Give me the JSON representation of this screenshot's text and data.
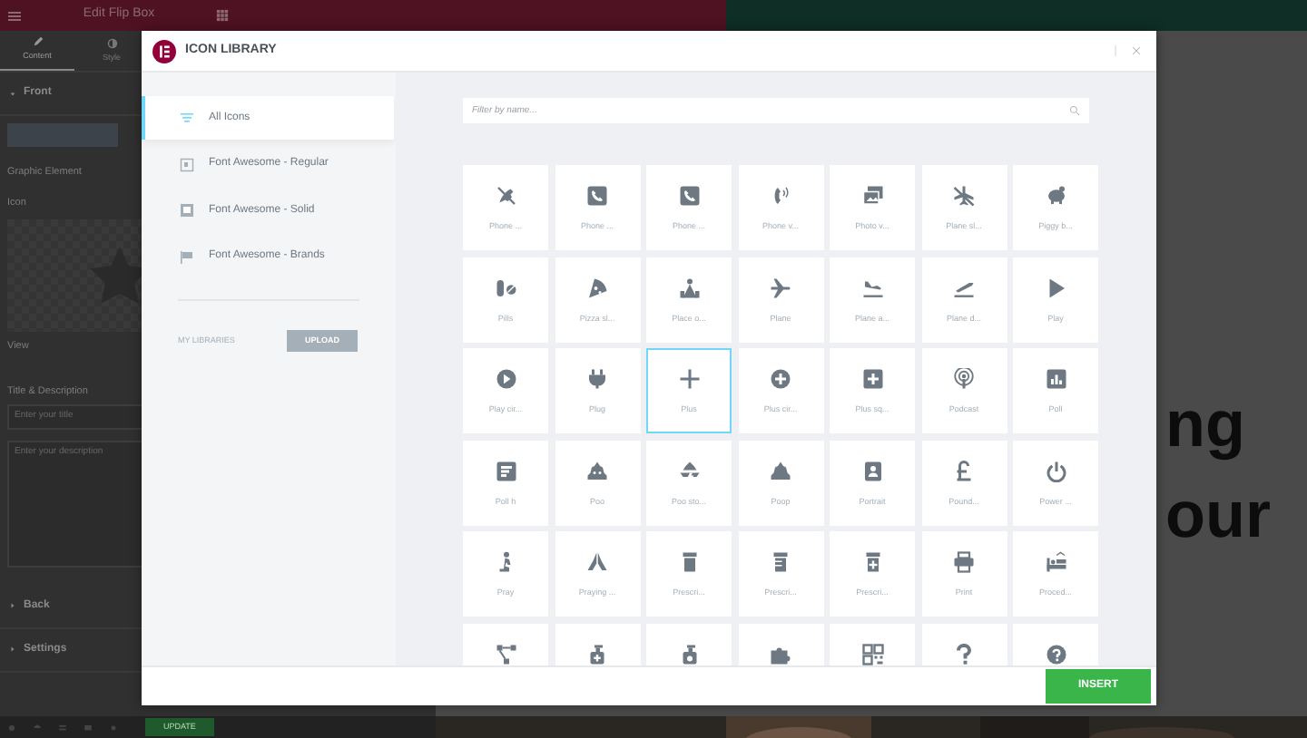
{
  "editor": {
    "title": "Edit Flip Box",
    "tabs": [
      {
        "label": "Content",
        "selected": true
      },
      {
        "label": "Style",
        "selected": false
      }
    ],
    "sections": [
      {
        "label": "Front",
        "expanded": true
      },
      {
        "label": "Back",
        "expanded": false
      },
      {
        "label": "Settings",
        "expanded": false
      }
    ],
    "graphic_element_label": "Graphic Element",
    "icon_label": "Icon",
    "view_label": "View",
    "title_description_label": "Title & Description",
    "title_field": {
      "placeholder": "Enter your title"
    },
    "description_field": {
      "placeholder": "Enter your description"
    },
    "update_button": "UPDATE"
  },
  "page": {
    "heading_lines": [
      "ng",
      "our"
    ]
  },
  "modal": {
    "title": "ICON LIBRARY",
    "categories": [
      {
        "label": "All Icons",
        "selected": true
      },
      {
        "label": "Font Awesome - Regular",
        "selected": false
      },
      {
        "label": "Font Awesome - Solid",
        "selected": false
      },
      {
        "label": "Font Awesome - Brands",
        "selected": false
      }
    ],
    "my_libraries_label": "MY LIBRARIES",
    "upload_button": "UPLOAD",
    "search": {
      "placeholder": "Filter by name..."
    },
    "icons": [
      {
        "label": "Phone ...",
        "selected": false
      },
      {
        "label": "Phone ...",
        "selected": false
      },
      {
        "label": "Phone ...",
        "selected": false
      },
      {
        "label": "Phone v...",
        "selected": false
      },
      {
        "label": "Photo v...",
        "selected": false
      },
      {
        "label": "Plane sl...",
        "selected": false
      },
      {
        "label": "Piggy b...",
        "selected": false
      },
      {
        "label": "Pills",
        "selected": false
      },
      {
        "label": "Pizza sl...",
        "selected": false
      },
      {
        "label": "Place o...",
        "selected": false
      },
      {
        "label": "Plane",
        "selected": false
      },
      {
        "label": "Plane a...",
        "selected": false
      },
      {
        "label": "Plane d...",
        "selected": false
      },
      {
        "label": "Play",
        "selected": false
      },
      {
        "label": "Play cir...",
        "selected": false
      },
      {
        "label": "Plug",
        "selected": false
      },
      {
        "label": "Plus",
        "selected": true
      },
      {
        "label": "Plus cir...",
        "selected": false
      },
      {
        "label": "Plus sq...",
        "selected": false
      },
      {
        "label": "Podcast",
        "selected": false
      },
      {
        "label": "Poll",
        "selected": false
      },
      {
        "label": "Poll h",
        "selected": false
      },
      {
        "label": "Poo",
        "selected": false
      },
      {
        "label": "Poo sto...",
        "selected": false
      },
      {
        "label": "Poop",
        "selected": false
      },
      {
        "label": "Portrait",
        "selected": false
      },
      {
        "label": "Pound...",
        "selected": false
      },
      {
        "label": "Power ...",
        "selected": false
      },
      {
        "label": "Pray",
        "selected": false
      },
      {
        "label": "Praying ...",
        "selected": false
      },
      {
        "label": "Prescri...",
        "selected": false
      },
      {
        "label": "Prescri...",
        "selected": false
      },
      {
        "label": "Prescri...",
        "selected": false
      },
      {
        "label": "Print",
        "selected": false
      },
      {
        "label": "Proced...",
        "selected": false
      },
      {
        "selected": false
      },
      {
        "selected": false
      },
      {
        "selected": false
      },
      {
        "selected": false
      },
      {
        "selected": false
      },
      {
        "selected": false
      },
      {
        "selected": false
      }
    ],
    "insert_button": "INSERT"
  }
}
